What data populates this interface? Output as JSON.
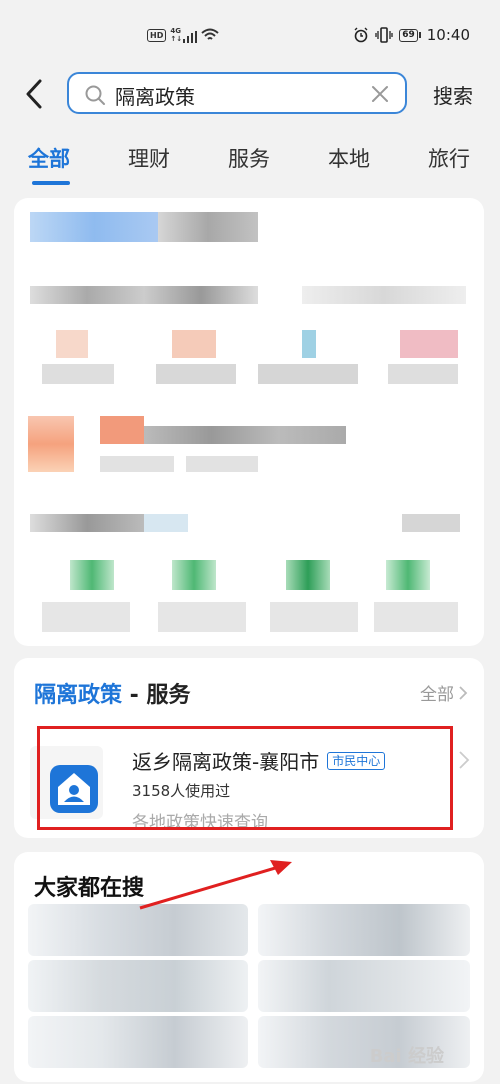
{
  "status_bar": {
    "left_badge": "HD",
    "signal_label": "4G",
    "signal_sub": "↑↓",
    "battery": "69",
    "time": "10:40",
    "icons": [
      "hd-icon",
      "signal-icon",
      "wifi-icon",
      "alarm-icon",
      "vibrate-icon",
      "battery-icon"
    ]
  },
  "search": {
    "query": "隔离政策",
    "button_label": "搜索"
  },
  "tabs": [
    {
      "label": "全部",
      "active": true
    },
    {
      "label": "理财",
      "active": false
    },
    {
      "label": "服务",
      "active": false
    },
    {
      "label": "本地",
      "active": false
    },
    {
      "label": "旅行",
      "active": false
    }
  ],
  "service_section": {
    "title_highlight": "隔离政策",
    "title_rest": " - 服务",
    "all_label": "全部",
    "item": {
      "name": "返乡隔离政策-襄阳市",
      "badge": "市民中心",
      "users": "3158人使用过",
      "description": "各地政策快速查询"
    },
    "accent": "#1e75d8"
  },
  "popular_section": {
    "title": "大家都在搜"
  },
  "watermark": "Bai 经验",
  "colors": {
    "accent": "#1e75d8",
    "highlight": "#e02020",
    "background": "#f2f2f2"
  }
}
